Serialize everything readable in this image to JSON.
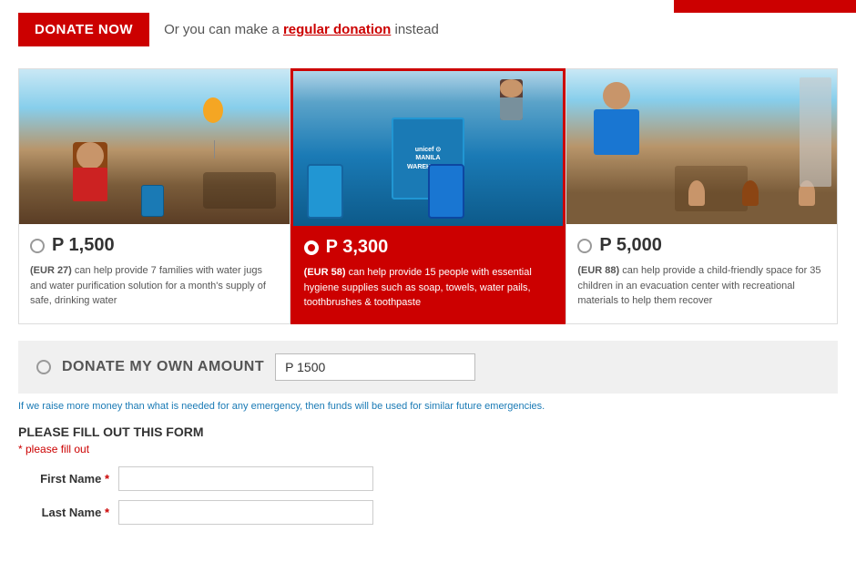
{
  "top": {
    "donate_button": "DONATE",
    "donate_button_suffix": " NOW",
    "tagline": "Or you can make a",
    "link_text": "regular donation",
    "tagline_end": "instead"
  },
  "cards": [
    {
      "id": "card1",
      "price": "P 1,500",
      "currency_note": "(EUR 27)",
      "description": "can help provide 7 families with water jugs and water purification solution for a month's supply of safe, drinking water",
      "selected": false
    },
    {
      "id": "card2",
      "price": "P 3,300",
      "currency_note": "(EUR 58)",
      "description": "can help provide 15 people with essential hygiene supplies such as soap, towels, water pails, toothbrushes & toothpaste",
      "selected": true
    },
    {
      "id": "card3",
      "price": "P 5,000",
      "currency_note": "(EUR 88)",
      "description": "can help provide a child-friendly space for 35 children in an evacuation center with recreational materials to help them recover",
      "selected": false
    }
  ],
  "own_amount": {
    "label": "DONATE MY OWN AMOUNT",
    "input_value": "P 1500"
  },
  "fund_info": "If we raise more money than what is needed for any emergency, then funds will be used for similar future emergencies.",
  "form": {
    "title": "PLEASE FILL OUT THIS FORM",
    "error_message": "* please fill out",
    "fields": [
      {
        "label": "First Name",
        "required": true,
        "placeholder": ""
      },
      {
        "label": "Last Name",
        "required": true,
        "placeholder": ""
      }
    ]
  }
}
